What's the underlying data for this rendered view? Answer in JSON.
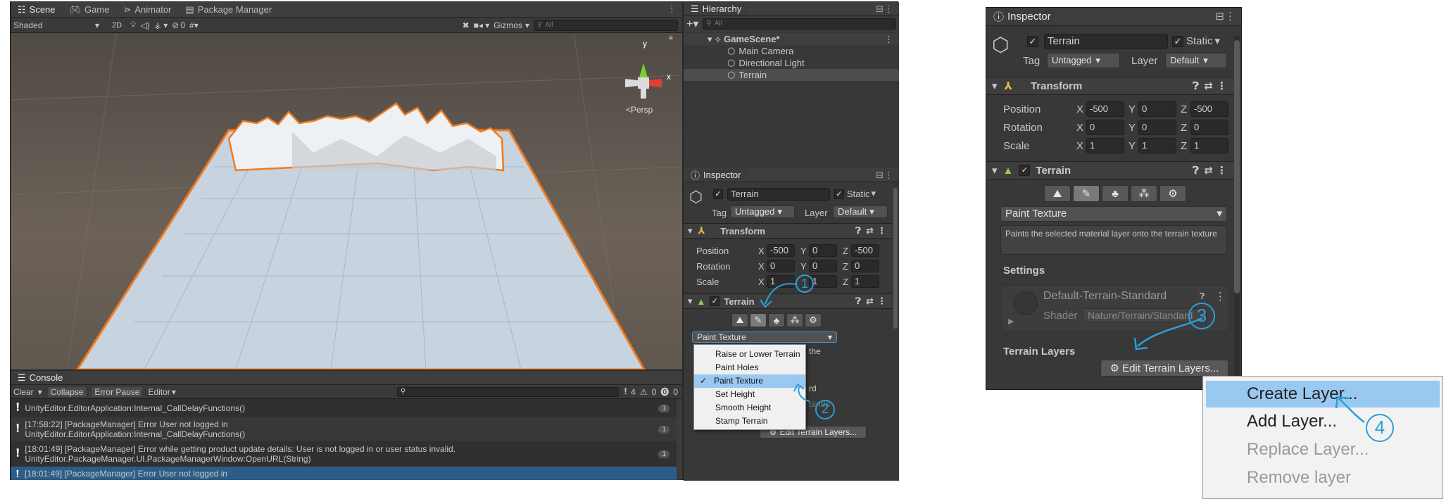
{
  "scene": {
    "tabs": [
      {
        "label": "Scene",
        "icon": "grid-icon"
      },
      {
        "label": "Game",
        "icon": "gamepad-icon"
      },
      {
        "label": "Animator",
        "icon": "animator-icon"
      },
      {
        "label": "Package Manager",
        "icon": "package-icon"
      }
    ],
    "shading": "Shaded",
    "mode_2d": "2D",
    "hidden_count": "0",
    "gizmos": "Gizmos",
    "search_placeholder": "All",
    "persp_label": "<Persp",
    "axis_y": "y",
    "axis_x": "x"
  },
  "hierarchy": {
    "title": "Hierarchy",
    "search_placeholder": "All",
    "scene_name": "GameScene*",
    "items": [
      "Main Camera",
      "Directional Light",
      "Terrain"
    ]
  },
  "console": {
    "title": "Console",
    "clear": "Clear",
    "collapse": "Collapse",
    "error_pause": "Error Pause",
    "editor": "Editor",
    "counts": {
      "warnings_a": "4",
      "warnings_b": "0",
      "errors": "0"
    },
    "entries": [
      {
        "line1": "",
        "line2": "UnityEditor.EditorApplication:Internal_CallDelayFunctions()",
        "count": "1"
      },
      {
        "line1": "[17:58:22] [PackageManager] Error User not logged in",
        "line2": "UnityEditor.EditorApplication:Internal_CallDelayFunctions()",
        "count": "1"
      },
      {
        "line1": "[18:01:49] [PackageManager] Error while getting product update details: User is not logged in or user status invalid.",
        "line2": "UnityEditor.PackageManager.UI.PackageManagerWindow:OpenURL(String)",
        "count": "1"
      },
      {
        "line1": "[18:01:49] [PackageManager] Error User not logged in",
        "line2": "",
        "count": ""
      }
    ]
  },
  "inspector": {
    "title": "Inspector",
    "object_name": "Terrain",
    "static_label": "Static",
    "tag_label": "Tag",
    "tag_value": "Untagged",
    "layer_label": "Layer",
    "layer_value": "Default",
    "transform": {
      "title": "Transform",
      "position_label": "Position",
      "rotation_label": "Rotation",
      "scale_label": "Scale",
      "position": {
        "x": "-500",
        "y": "0",
        "z": "-500"
      },
      "rotation": {
        "x": "0",
        "y": "0",
        "z": "0"
      },
      "scale": {
        "x": "1",
        "y": "1",
        "z": "1"
      }
    },
    "terrain": {
      "title": "Terrain",
      "mode": "Paint Texture",
      "help_text": "Paints the selected material layer onto the terrain texture",
      "partial_help": "the",
      "settings_label": "Settings",
      "material_name": "Default-Terrain-Standard",
      "partial_material": "rd",
      "partial_shader": "tanda",
      "shader_label": "Shader",
      "shader_value": "Nature/Terrain/Standard",
      "layers_label": "Terrain Layers",
      "edit_layers": "Edit Terrain Layers..."
    }
  },
  "paint_menu": {
    "items": [
      "Raise or Lower Terrain",
      "Paint Holes",
      "Paint Texture",
      "Set Height",
      "Smooth Height",
      "Stamp Terrain"
    ],
    "selected": "Paint Texture"
  },
  "layers_menu": {
    "items": [
      "Create Layer...",
      "Add Layer...",
      "Replace Layer...",
      "Remove layer"
    ]
  },
  "annotations": {
    "step1": "1",
    "step2": "2",
    "step3": "3",
    "step4": "4"
  },
  "colors": {
    "accent": "#2a9fd8",
    "selection": "#2c5d87",
    "menu_highlight": "#99c8f0",
    "outline": "#f07a1e"
  }
}
